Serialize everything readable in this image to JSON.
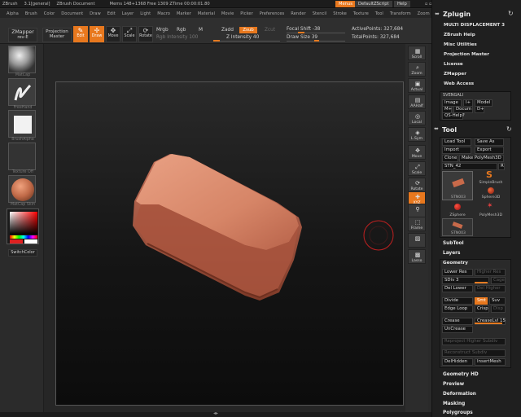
{
  "title_bar": {
    "app": "ZBrush",
    "doc_state": "3.1[general]",
    "document": "ZBrush Document",
    "mem": "Mems 148+1368 Free 1309 ZTime 00:00:01.80",
    "menus_btn": "Menus",
    "script_btn": "DefaultZScript",
    "help_btn": "Help"
  },
  "menu_bar": [
    "Alpha",
    "Brush",
    "Color",
    "Document",
    "Draw",
    "Edit",
    "Layer",
    "Light",
    "Macro",
    "Marker",
    "Material",
    "Movie",
    "Picker",
    "Preferences",
    "Render",
    "Stencil",
    "Stroke",
    "Texture",
    "Tool",
    "Transform",
    "Zoom",
    "Zplugin",
    "Zscript"
  ],
  "shelf": {
    "zmapper": "ZMapper",
    "zmapper_sub": "rev-E",
    "projection": "Projection",
    "projection_sub": "Master",
    "edit": "Edit",
    "draw": "Draw",
    "move": "Move",
    "scale": "Scale",
    "rotate": "Rotate",
    "mrgb": "Mrgb",
    "rgb": "Rgb",
    "m": "M",
    "zadd": "Zadd",
    "zsub": "Zsub",
    "zcut": "Zcut",
    "rgb_intensity": "Rgb Intensity 100",
    "z_intensity": "Z Intensity 40",
    "focal_shift": "Focal Shift -38",
    "draw_size": "Draw Size 39",
    "active_points": "ActivePoints: 327,684",
    "total_points": "TotalPoints: 327,684"
  },
  "left_tray": {
    "material": "MatCap",
    "brush": "FreeHand",
    "stroke": "BrushAlpha",
    "texture": "Texture Off",
    "material2": "MatCap Skin",
    "switch_color": "SwitchColor"
  },
  "right_tray": [
    {
      "icon": "▦",
      "label": "Scroll"
    },
    {
      "icon": "⌕",
      "label": "Zoom"
    },
    {
      "icon": "▣",
      "label": "Actual"
    },
    {
      "icon": "▤",
      "label": "AAHalf"
    },
    {
      "icon": "◎",
      "label": "Local"
    },
    {
      "icon": "◈",
      "label": "L.Sym"
    },
    {
      "icon": "✥",
      "label": "Move"
    },
    {
      "icon": "⤢",
      "label": "Scale"
    },
    {
      "icon": "⟳",
      "label": "Rotate"
    },
    {
      "icon": "✚",
      "label": "XYZ"
    },
    {
      "icon": "⚲",
      "label": ""
    },
    {
      "icon": "⬚",
      "label": "Frame"
    },
    {
      "icon": "▨",
      "label": ""
    },
    {
      "icon": "▩",
      "label": "Lasso"
    }
  ],
  "zplugin": {
    "header": "Zplugin",
    "items": [
      "MULTI DISPLACEMENT 3",
      "ZBrush Help",
      "Misc Utilities",
      "Projection Master",
      "License",
      "ZMapper",
      "Web Access"
    ],
    "subtool_group": "SVENGALI",
    "image": "Image",
    "i_plus": "I+",
    "model": "Model",
    "m_plus": "M+",
    "docum": "Docum",
    "d_plus": "D+",
    "qs_help": "QS-Help?"
  },
  "tool": {
    "header": "Tool",
    "load_tool": "Load Tool",
    "save_as": "Save As",
    "import": "Import",
    "export": "Export",
    "clone": "Clone",
    "make_polymesh": "Make PolyMesh3D",
    "stn": "STN_42",
    "r": "R",
    "tool_names": [
      "STN003",
      "SimpleBrush",
      "Sphere3D",
      "ZSphere",
      "PolyMesh3D",
      "STN003"
    ],
    "subtool": "SubTool",
    "layers": "Layers",
    "geometry": "Geometry",
    "lower_res": "Lower Res",
    "higher_res": "Higher Res",
    "sdiv": "SDiv 3",
    "cage": "Cage",
    "del_lower": "Del Lower",
    "del_higher": "Del Higher",
    "divide": "Divide",
    "smt": "Smt",
    "suv": "Suv",
    "edge_loop": "Edge Loop",
    "crisp": "Crisp",
    "disp": "Disp",
    "crease": "Crease",
    "crease_lvl": "CreaseLvl 15",
    "uncrease": "UnCrease",
    "reproject": "Reproject Higher Subdiv",
    "reconstruct": "Reconstruct Subdiv",
    "del_hidden": "DelHidden",
    "insert_mesh": "InsertMesh",
    "geometry_hd": "Geometry HD",
    "preview": "Preview",
    "deformation": "Deformation",
    "masking": "Masking",
    "polygroups": "Polygroups"
  }
}
